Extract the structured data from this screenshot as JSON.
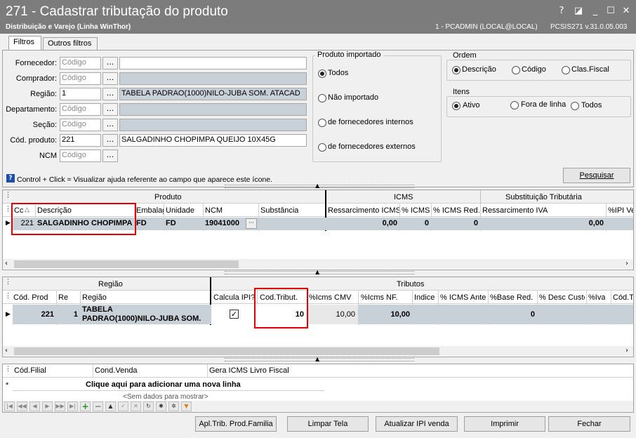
{
  "window": {
    "title": "271 - Cadastrar tributação do produto",
    "subtitle": "Distribuição e Varejo (Linha WinThor)",
    "user_info": "1 - PCADMIN (LOCAL@LOCAL)",
    "version": "PCSIS271  v.31.0.05.003",
    "controls": [
      "?",
      "◪",
      "_",
      "☐",
      "✕"
    ]
  },
  "tabs": [
    "Filtros",
    "Outros filtros"
  ],
  "filters": {
    "fornecedor": {
      "label": "Fornecedor:",
      "placeholder": "Código",
      "desc": ""
    },
    "comprador": {
      "label": "Comprador:",
      "placeholder": "Código",
      "desc": ""
    },
    "regiao": {
      "label": "Região:",
      "value": "1",
      "desc": "TABELA PADRAO(1000)NILO-JUBA SOM. ATACAD"
    },
    "departamento": {
      "label": "Departamento:",
      "placeholder": "Código",
      "desc": ""
    },
    "secao": {
      "label": "Seção:",
      "placeholder": "Código",
      "desc": ""
    },
    "cod_produto": {
      "label": "Cód. produto:",
      "value": "221",
      "desc": "SALGADINHO CHOPIMPA QUEIJO 10X45G"
    },
    "ncm": {
      "label": "NCM",
      "placeholder": "Código"
    },
    "dots": "..."
  },
  "produto_importado": {
    "title": "Produto importado",
    "options": [
      "Todos",
      "Não importado",
      "de fornecedores internos",
      "de fornecedores externos"
    ],
    "selected": "Todos"
  },
  "ordem": {
    "title": "Ordem",
    "options": [
      "Descrição",
      "Código",
      "Clas.Fiscal"
    ],
    "selected": "Descrição"
  },
  "itens": {
    "title": "Itens",
    "options": [
      "Ativo",
      "Fora de linha",
      "Todos"
    ],
    "selected": "Ativo"
  },
  "help_text": "Control + Click = Visualizar ajuda referente ao campo que aparece este ícone.",
  "pesquisar_label": "Pesquisar",
  "grid1": {
    "bands": [
      "Produto",
      "ICMS",
      "Substituição Tributária"
    ],
    "columns": [
      "Cc",
      "Descrição",
      "Embalag",
      "Unidade",
      "NCM",
      "Substância",
      "Ressarcimento ICMS",
      "% ICMS",
      "% ICMS Red.",
      "Ressarcimento IVA",
      "%IPI Ve"
    ],
    "row": {
      "cod": "221",
      "descricao": "SALGADINHO CHOPIMPA",
      "embalagem": "FD",
      "unidade": "FD",
      "ncm": "19041000",
      "ncm_btn": "···",
      "substancia": "",
      "ress_icms": "0,00",
      "pct_icms": "0",
      "pct_icms_red": "0",
      "ress_iva": "0,00",
      "ipi": ""
    }
  },
  "grid2": {
    "bands": [
      "Região",
      "Tributos"
    ],
    "columns": [
      "Cód. Prod",
      "Re",
      "Região",
      "Calcula IPI?",
      "Cod.Tribut.",
      "%Icms CMV",
      "%Icms NF.",
      "Indice",
      "% ICMS Ante",
      "%Base Red.",
      "% Desc Custo",
      "%Iva",
      "Cód.T"
    ],
    "row": {
      "cod": "221",
      "re": "1",
      "regiao_l1": "TABELA",
      "regiao_l2": "PADRAO(1000)NILO-JUBA SOM.",
      "calcula_ipi": "✓",
      "cod_tribut": "10",
      "icms_cmv": "10,00",
      "icms_nf": "10,00",
      "indice": "",
      "icms_ante": "",
      "base_red": "0",
      "desc_custo": "",
      "iva": "",
      "cod_t": ""
    }
  },
  "grid3": {
    "columns": [
      "Cód.Filial",
      "Cond.Venda",
      "Gera ICMS Livro Fiscal"
    ],
    "new_row": "Clique aqui para adicionar uma nova linha",
    "empty": "<Sem dados para mostrar>",
    "indicator": "*"
  },
  "buttons": {
    "apl_trib": "Apl.Trib. Prod.Familia",
    "limpar": "Limpar Tela",
    "atualizar": "Atualizar IPI venda",
    "imprimir": "Imprimir",
    "fechar": "Fechar"
  },
  "colors": {
    "titlebar": "#7c7c7c",
    "highlight": "#e00000",
    "readonly": "#c8d0d8",
    "row_selected": "#c8d0d8"
  }
}
